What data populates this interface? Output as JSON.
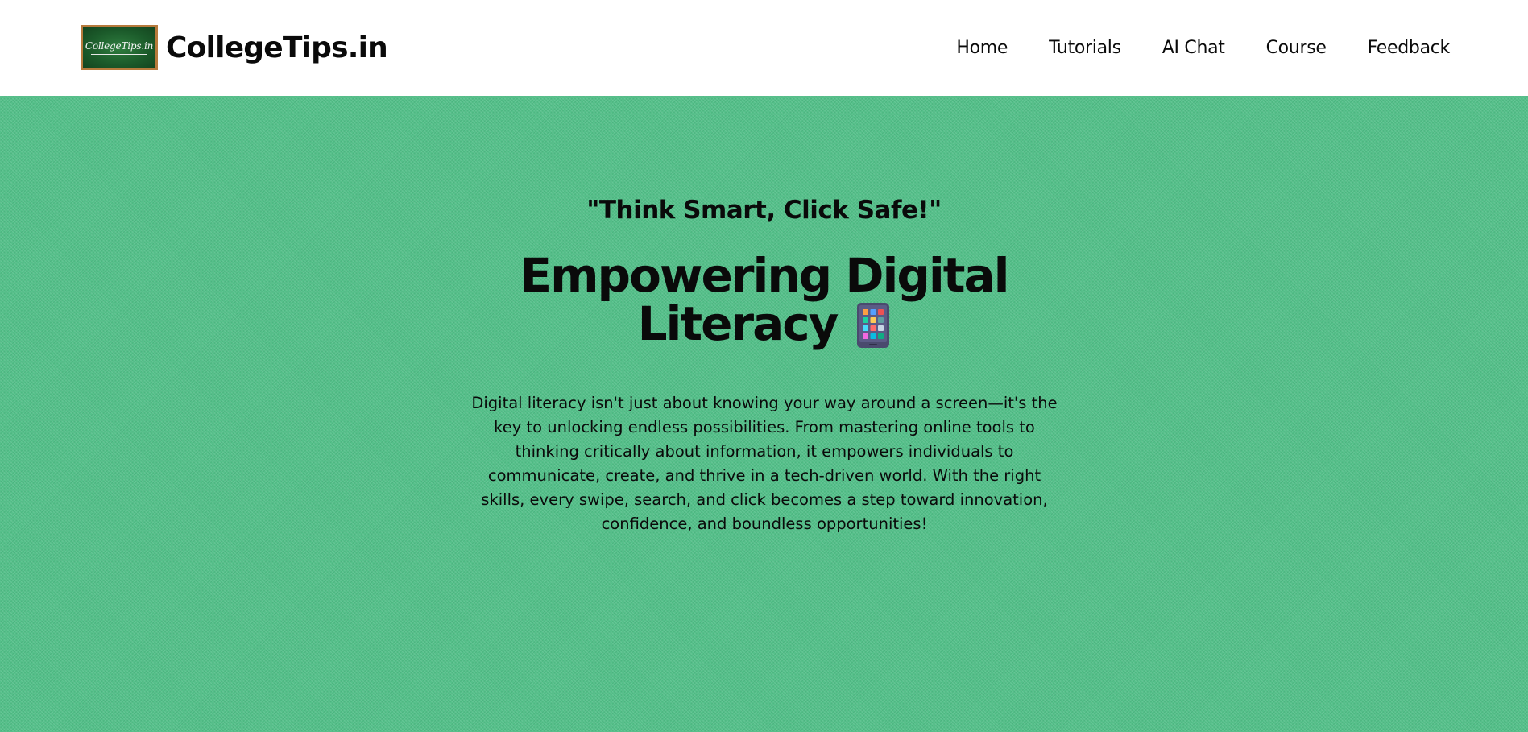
{
  "header": {
    "logo_text": "CollegeTips.in",
    "brand_name": "CollegeTips.in",
    "nav": [
      {
        "label": "Home"
      },
      {
        "label": "Tutorials"
      },
      {
        "label": "AI Chat"
      },
      {
        "label": "Course"
      },
      {
        "label": "Feedback"
      }
    ]
  },
  "hero": {
    "tagline": "\"Think Smart, Click Safe!\"",
    "headline_line1": "Empowering Digital",
    "headline_line2": "Literacy",
    "headline_icon": "mobile-phone-icon",
    "description": "Digital literacy isn't just about knowing your way around a screen—it's the key to unlocking endless possibilities. From mastering online tools to thinking critically about information, it empowers individuals to communicate, create, and thrive in a tech-driven world. With the right skills, every swipe, search, and click becomes a step toward innovation, confidence, and boundless opportunities!"
  },
  "colors": {
    "hero_background": "#55c08a",
    "header_background": "#ffffff",
    "logo_board": "#1b5a2a",
    "logo_frame": "#b77a3c"
  }
}
